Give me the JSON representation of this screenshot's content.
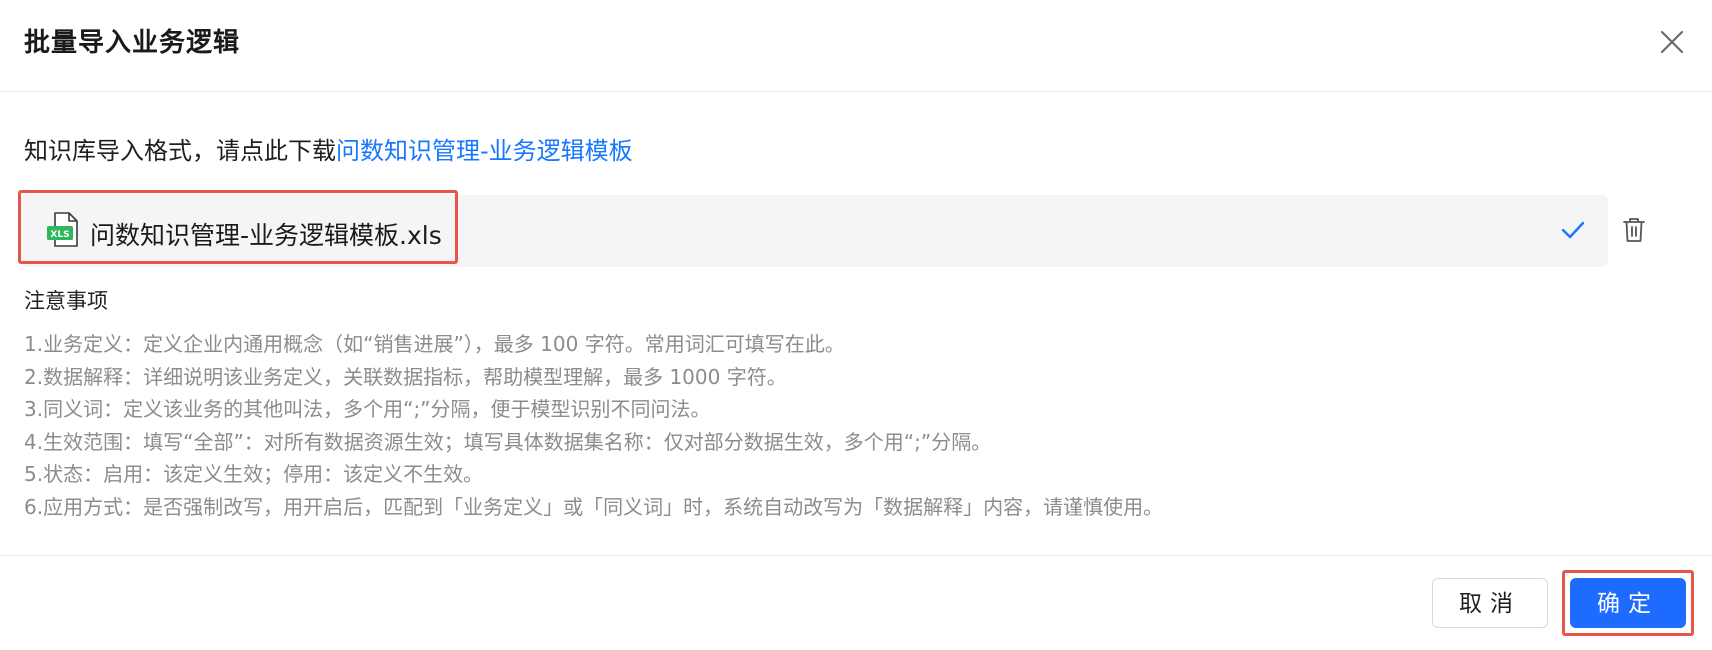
{
  "dialog": {
    "title": "批量导入业务逻辑",
    "close_icon": "close-icon"
  },
  "template": {
    "prefix": "知识库导入格式，请点此下载",
    "link_text": "问数知识管理-业务逻辑模板"
  },
  "file": {
    "icon": "xls-file-icon",
    "icon_label": "XLS",
    "name": "问数知识管理-业务逻辑模板.xls",
    "status_icon": "check-icon",
    "delete_icon": "trash-icon"
  },
  "notes": {
    "title": "注意事项",
    "items": [
      "1.业务定义：定义企业内通用概念（如“销售进展”），最多 100 字符。常用词汇可填写在此。",
      "2.数据解释：详细说明该业务定义，关联数据指标，帮助模型理解，最多 1000 字符。",
      "3.同义词：定义该业务的其他叫法，多个用“;”分隔，便于模型识别不同问法。",
      "4.生效范围：填写“全部”：对所有数据资源生效；填写具体数据集名称：仅对部分数据生效，多个用“;”分隔。",
      "5.状态：启用：该定义生效；停用：该定义不生效。",
      "6.应用方式：是否强制改写，用开启后，匹配到「业务定义」或「同义词」时，系统自动改写为「数据解释」内容，请谨慎使用。"
    ]
  },
  "footer": {
    "cancel_label": "取消",
    "confirm_label": "确定"
  },
  "colors": {
    "accent": "#1677ff",
    "primary_button": "#1e6cff",
    "highlight": "#e8564a",
    "xls_green": "#2eb85c"
  }
}
